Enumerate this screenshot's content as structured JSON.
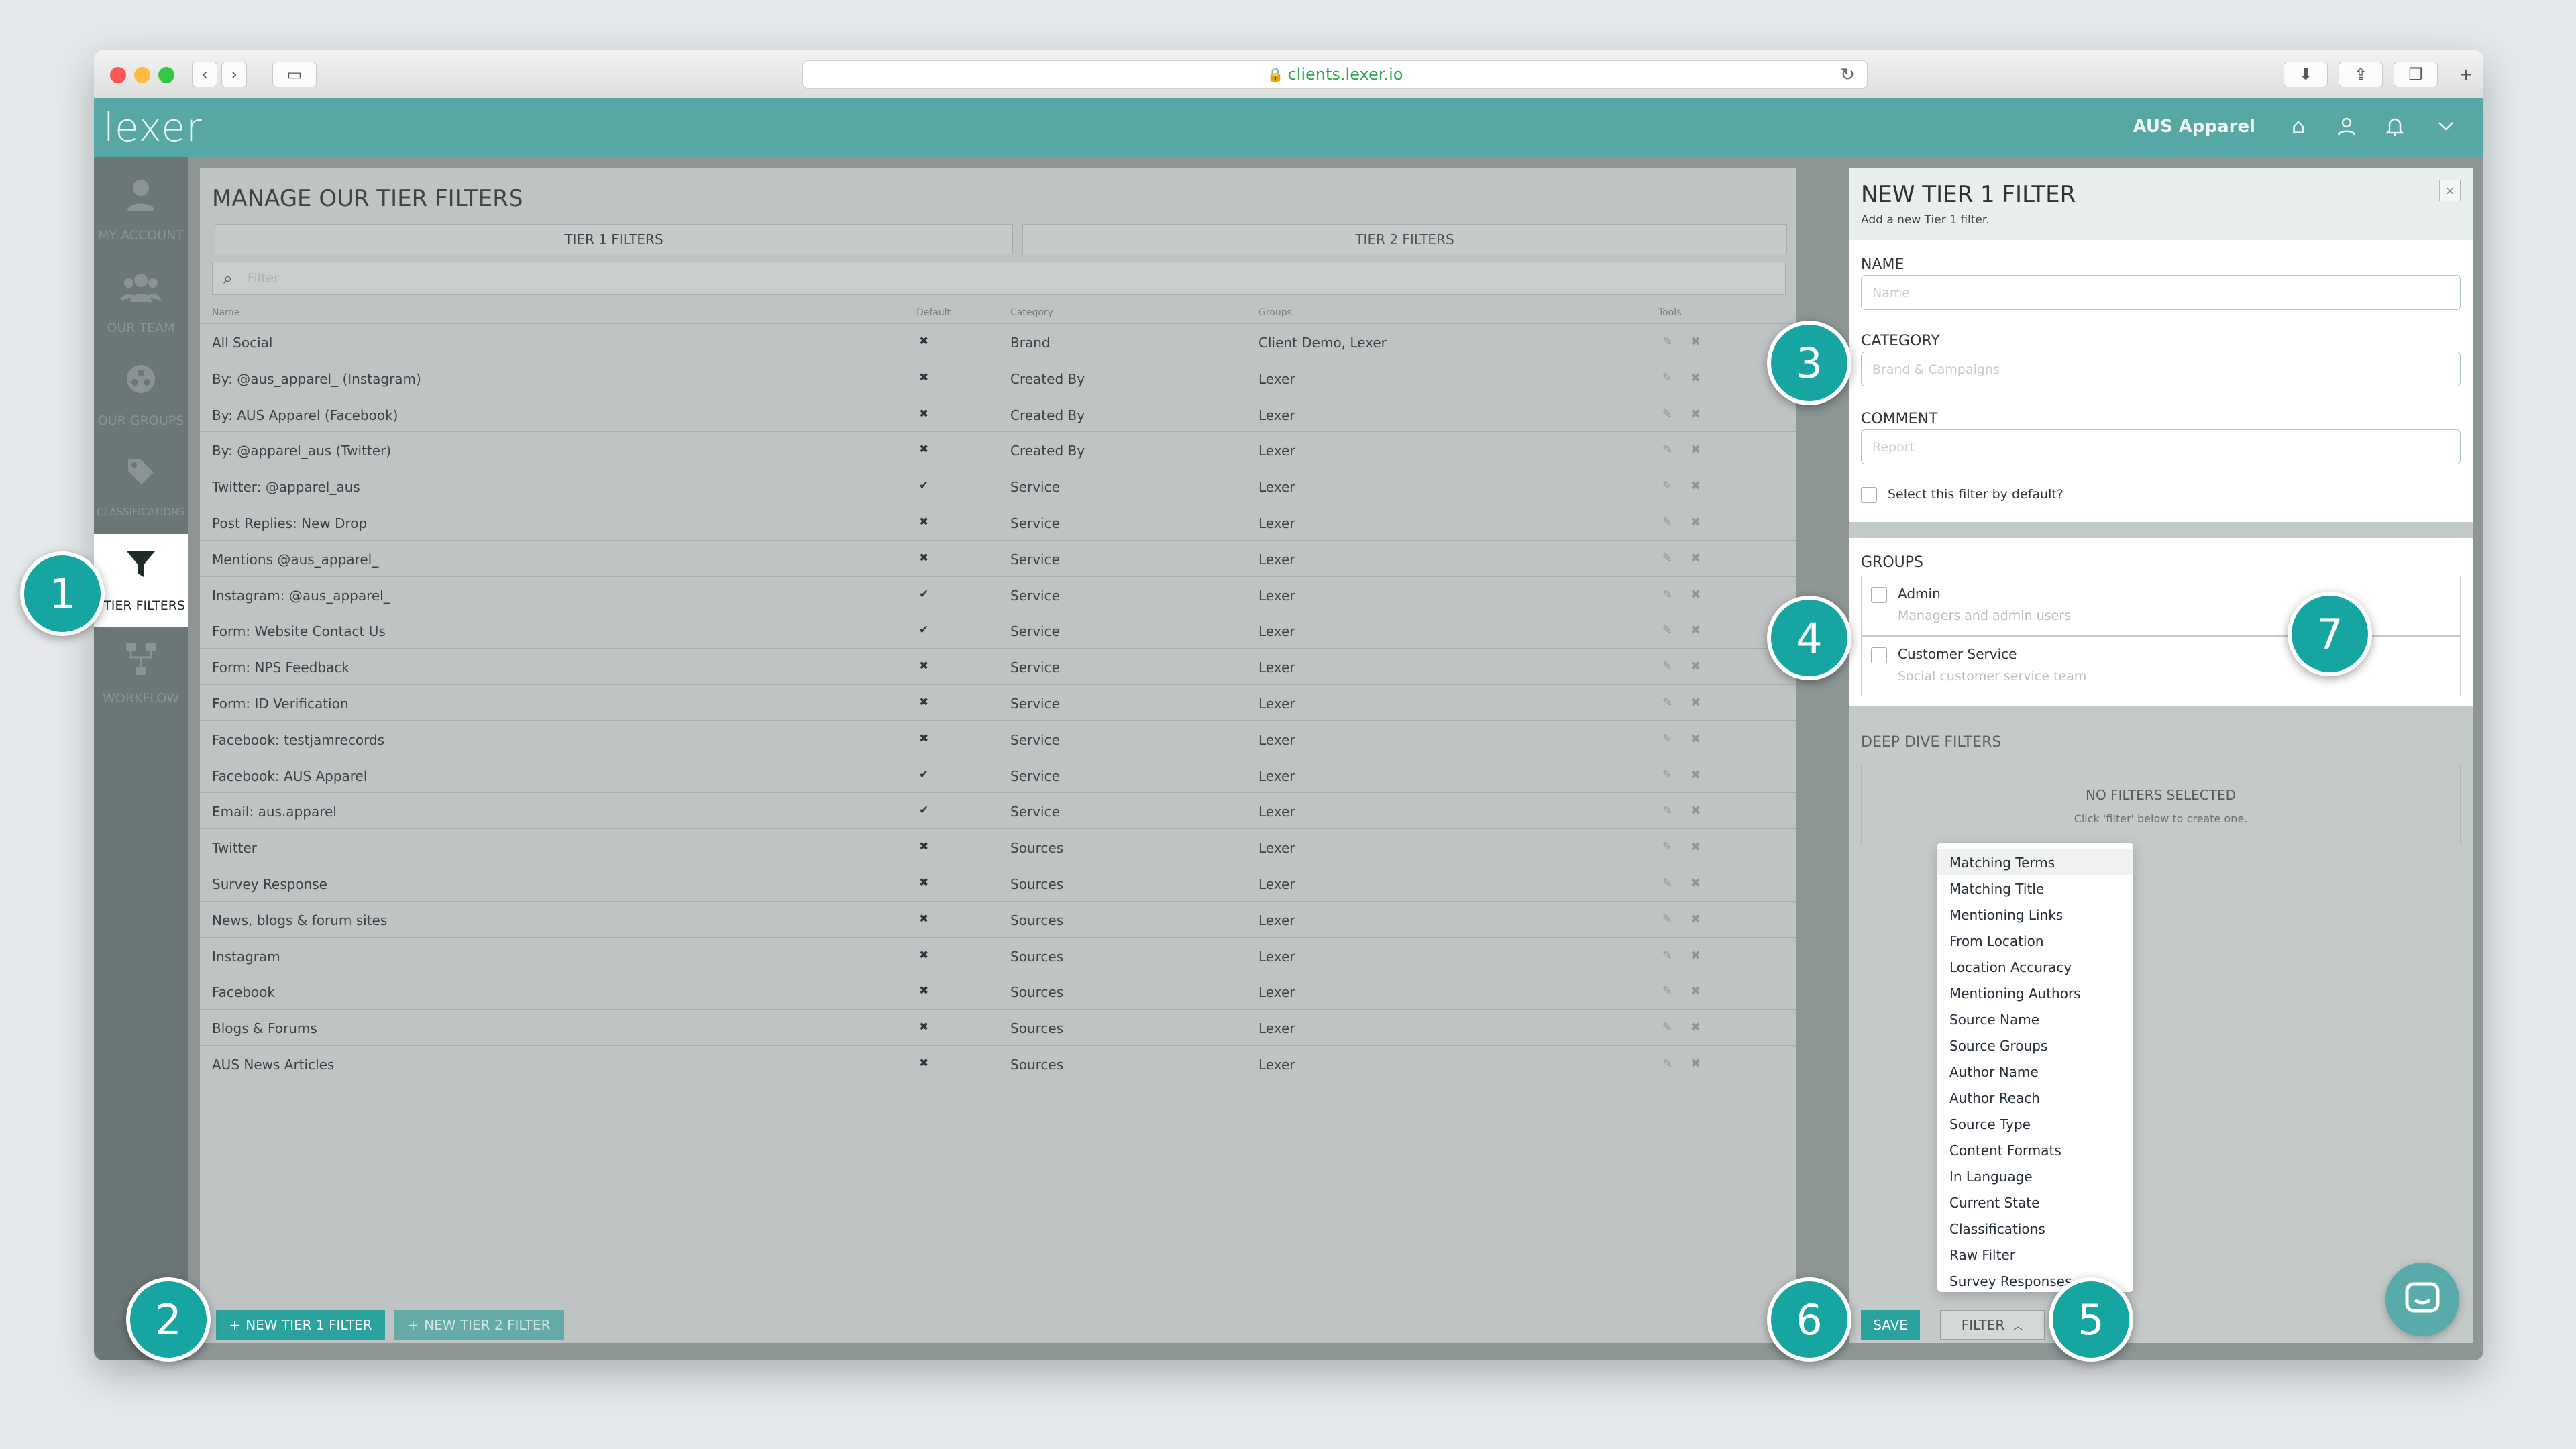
{
  "browser": {
    "url": "clients.lexer.io"
  },
  "app": {
    "logo": "lexer",
    "account": "AUS Apparel"
  },
  "sidebar": [
    {
      "label": "MY ACCOUNT",
      "icon": "user-icon"
    },
    {
      "label": "OUR TEAM",
      "icon": "team-icon"
    },
    {
      "label": "OUR GROUPS",
      "icon": "groups-icon"
    },
    {
      "label": "CLASSIFICATIONS",
      "icon": "tag-icon"
    },
    {
      "label": "TIER FILTERS",
      "icon": "funnel-icon"
    },
    {
      "label": "WORKFLOW",
      "icon": "workflow-icon"
    }
  ],
  "main": {
    "title": "MANAGE OUR TIER FILTERS",
    "tabs": [
      "TIER 1 FILTERS",
      "TIER 2 FILTERS"
    ],
    "filter_placeholder": "Filter",
    "columns": [
      "Name",
      "Default",
      "Category",
      "Groups",
      "Tools"
    ],
    "rows": [
      {
        "name": "All Social",
        "default": "✖",
        "category": "Brand",
        "groups": "Client Demo, Lexer"
      },
      {
        "name": "By: @aus_apparel_ (Instagram)",
        "default": "✖",
        "category": "Created By",
        "groups": "Lexer"
      },
      {
        "name": "By: AUS Apparel (Facebook)",
        "default": "✖",
        "category": "Created By",
        "groups": "Lexer"
      },
      {
        "name": "By: @apparel_aus (Twitter)",
        "default": "✖",
        "category": "Created By",
        "groups": "Lexer"
      },
      {
        "name": "Twitter: @apparel_aus",
        "default": "✔",
        "category": "Service",
        "groups": "Lexer"
      },
      {
        "name": "Post Replies: New Drop",
        "default": "✖",
        "category": "Service",
        "groups": "Lexer"
      },
      {
        "name": "Mentions @aus_apparel_",
        "default": "✖",
        "category": "Service",
        "groups": "Lexer"
      },
      {
        "name": "Instagram: @aus_apparel_",
        "default": "✔",
        "category": "Service",
        "groups": "Lexer"
      },
      {
        "name": "Form: Website Contact Us",
        "default": "✔",
        "category": "Service",
        "groups": "Lexer"
      },
      {
        "name": "Form: NPS Feedback",
        "default": "✖",
        "category": "Service",
        "groups": "Lexer"
      },
      {
        "name": "Form: ID Verification",
        "default": "✖",
        "category": "Service",
        "groups": "Lexer"
      },
      {
        "name": "Facebook: testjamrecords",
        "default": "✖",
        "category": "Service",
        "groups": "Lexer"
      },
      {
        "name": "Facebook: AUS Apparel",
        "default": "✔",
        "category": "Service",
        "groups": "Lexer"
      },
      {
        "name": "Email: aus.apparel",
        "default": "✔",
        "category": "Service",
        "groups": "Lexer"
      },
      {
        "name": "Twitter",
        "default": "✖",
        "category": "Sources",
        "groups": "Lexer"
      },
      {
        "name": "Survey Response",
        "default": "✖",
        "category": "Sources",
        "groups": "Lexer"
      },
      {
        "name": "News, blogs & forum sites",
        "default": "✖",
        "category": "Sources",
        "groups": "Lexer"
      },
      {
        "name": "Instagram",
        "default": "✖",
        "category": "Sources",
        "groups": "Lexer"
      },
      {
        "name": "Facebook",
        "default": "✖",
        "category": "Sources",
        "groups": "Lexer"
      },
      {
        "name": "Blogs & Forums",
        "default": "✖",
        "category": "Sources",
        "groups": "Lexer"
      },
      {
        "name": "AUS News Articles",
        "default": "✖",
        "category": "Sources",
        "groups": "Lexer"
      }
    ],
    "new_tier1": "NEW TIER 1 FILTER",
    "new_tier2": "NEW TIER 2 FILTER"
  },
  "panel": {
    "title": "NEW TIER 1 FILTER",
    "subtitle": "Add a new Tier 1 filter.",
    "name_label": "NAME",
    "name_placeholder": "Name",
    "category_label": "CATEGORY",
    "category_placeholder": "Brand & Campaigns",
    "comment_label": "COMMENT",
    "comment_placeholder": "Report",
    "default_label": "Select this filter by default?",
    "groups_label": "GROUPS",
    "groups": [
      {
        "name": "Admin",
        "desc": "Managers and admin users"
      },
      {
        "name": "Customer Service",
        "desc": "Social customer service team"
      }
    ],
    "deep_dive_label": "DEEP DIVE FILTERS",
    "no_filters": "NO FILTERS SELECTED",
    "no_filters_hint": "Click 'filter' below to create one.",
    "save": "SAVE",
    "filter": "FILTER"
  },
  "filter_menu": [
    "Matching Terms",
    "Matching Title",
    "Mentioning Links",
    "From Location",
    "Location Accuracy",
    "Mentioning Authors",
    "Source Name",
    "Source Groups",
    "Author Name",
    "Author Reach",
    "Source Type",
    "Content Formats",
    "In Language",
    "Current State",
    "Classifications",
    "Raw Filter",
    "Survey Responses"
  ],
  "callouts": [
    "1",
    "2",
    "3",
    "4",
    "5",
    "6",
    "7"
  ],
  "colors": {
    "teal": "#57a8a4",
    "callout": "#17a5a1",
    "button": "#2aa39f"
  }
}
